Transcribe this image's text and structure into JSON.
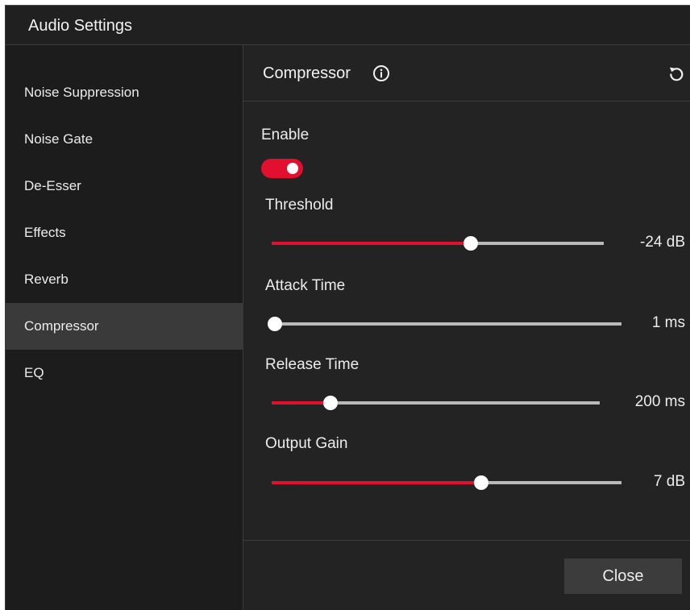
{
  "window": {
    "title": "Audio Settings"
  },
  "sidebar": {
    "items": [
      {
        "label": "Noise Suppression",
        "active": false
      },
      {
        "label": "Noise Gate",
        "active": false
      },
      {
        "label": "De-Esser",
        "active": false
      },
      {
        "label": "Effects",
        "active": false
      },
      {
        "label": "Reverb",
        "active": false
      },
      {
        "label": "Compressor",
        "active": true
      },
      {
        "label": "EQ",
        "active": false
      }
    ]
  },
  "panel": {
    "title": "Compressor",
    "info_icon": "info-icon",
    "reset_icon": "reset-icon",
    "enable": {
      "label": "Enable",
      "on": true
    },
    "sliders": [
      {
        "label": "Threshold",
        "value_text": "-24 dB",
        "fraction": 0.6
      },
      {
        "label": "Attack Time",
        "value_text": "1 ms",
        "fraction": 0.0
      },
      {
        "label": "Release Time",
        "value_text": "200 ms",
        "fraction": 0.18
      },
      {
        "label": "Output Gain",
        "value_text": "7 dB",
        "fraction": 0.6
      }
    ],
    "close_label": "Close"
  },
  "colors": {
    "accent": "#e2102e",
    "track": "#b9b9b9",
    "background": "#1e1e1e",
    "selected": "#3a3a3a"
  }
}
